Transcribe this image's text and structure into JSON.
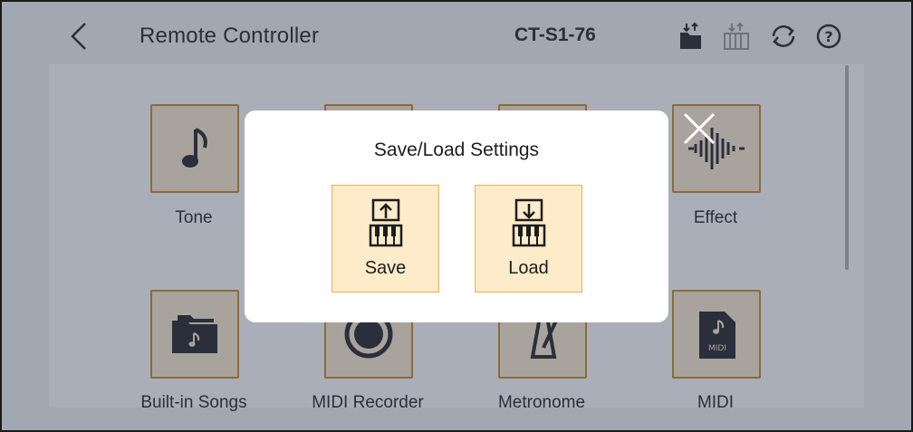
{
  "header": {
    "title": "Remote Controller",
    "model": "CT-S1-76",
    "icons": [
      "back-chevron-icon",
      "save-load-icon",
      "keyboard-transfer-icon",
      "sync-icon",
      "help-icon"
    ]
  },
  "tiles": [
    {
      "label": "Tone",
      "icon": "music-note-icon"
    },
    {
      "label": "Effect",
      "icon": "waveform-icon"
    },
    {
      "label": "Built-in Songs",
      "icon": "folder-music-icon"
    },
    {
      "label": "MIDI Recorder",
      "icon": "record-icon"
    },
    {
      "label": "Metronome",
      "icon": "metronome-icon"
    },
    {
      "label": "MIDI",
      "icon": "midi-file-icon"
    }
  ],
  "midi_icon_text": "MIDI",
  "dialog": {
    "title": "Save/Load Settings",
    "save_label": "Save",
    "load_label": "Load"
  },
  "colors": {
    "overlay_bg": "#a3a7b1",
    "button_bg": "#fdebc9",
    "button_border": "#e3b261",
    "tile_border": "#8a6c3a"
  }
}
